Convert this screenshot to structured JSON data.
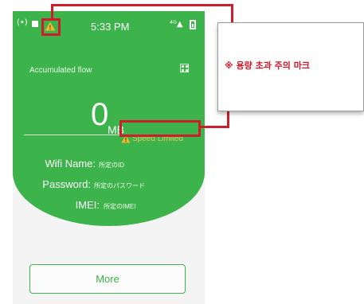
{
  "status_bar": {
    "signal_glyph": "(•)",
    "warning_glyph": "!",
    "time": "5:33 PM",
    "network_glyph": "⁴ᴳ▲"
  },
  "main": {
    "accumulated_label": "Accumulated flow",
    "flow_value": "0",
    "flow_unit": "MB",
    "speed_status": "Speed Limited",
    "wifi_label": "Wifi Name:",
    "wifi_value": "所定のID",
    "password_label": "Password:",
    "password_value": "所定のパスワード",
    "imei_label": "IMEI:",
    "imei_value": "所定のIMEI",
    "more_label": "More"
  },
  "annotation": {
    "callout_text": "※ 용량 초과 주의 마크"
  },
  "colors": {
    "green": "#3db34b",
    "highlight_red": "#cc1f2b",
    "warning_yellow": "#f2b731"
  }
}
